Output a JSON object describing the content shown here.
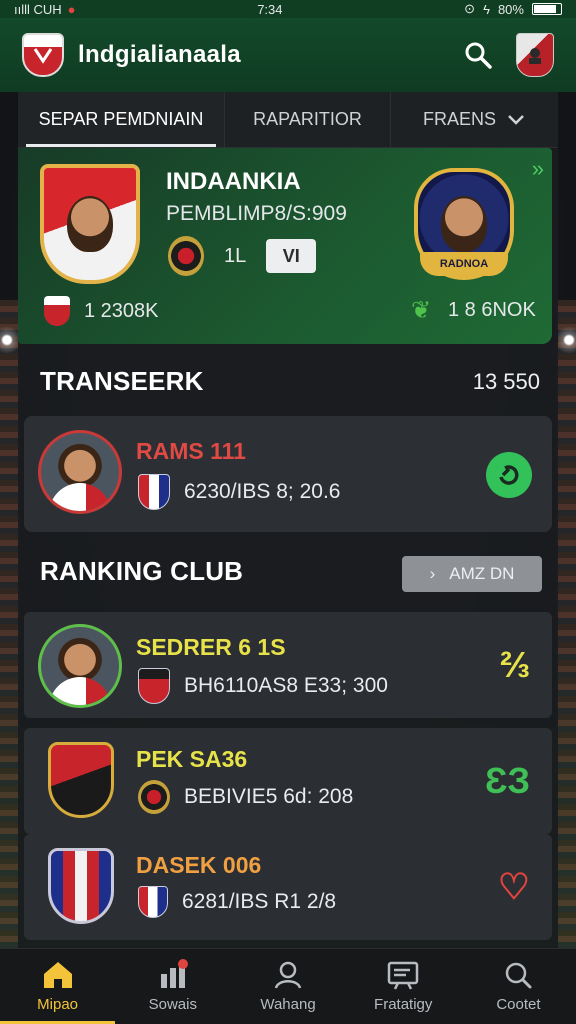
{
  "status_bar": {
    "carrier": "ıılll CUH",
    "time": "7:34",
    "battery": "80%"
  },
  "app_bar": {
    "title": "lndgialianaala"
  },
  "tabs": [
    {
      "label": "SEPAR PEMDNIAIN",
      "active": true
    },
    {
      "label": "RAPARITIOR",
      "active": false
    },
    {
      "label": "FRAENS",
      "active": false
    }
  ],
  "match": {
    "home_name": "INDAANKIA",
    "meta": "PEMBLIMP8/S:909",
    "score": "1L",
    "vs_label": "VI",
    "away_label": "RADNOA",
    "stat_left": "1 2308K",
    "stat_right": "1 8 6NOK"
  },
  "transfer": {
    "heading": "TRANSEERK",
    "count": "13 550",
    "card": {
      "title": "RAMS 111",
      "detail": "6230/IBS 8; 20.6"
    }
  },
  "ranking": {
    "heading": "RANKING CLUB",
    "see_all": "AMZ DN",
    "items": [
      {
        "title": "SEDRER 6 1S",
        "detail": "BH6110AS8 E33; 300",
        "title_color": "#e8e24a",
        "icon": "⅔",
        "icon_color": "#e8e24a"
      },
      {
        "title": "PEK SA36",
        "detail": "BEBIVIE5 6d: 208",
        "title_color": "#e8e24a",
        "icon": "ƐЗ",
        "icon_color": "#3fbf55"
      },
      {
        "title": "DASEK 006",
        "detail": "6281/IBS R1 2/8",
        "title_color": "#f0a042",
        "icon": "♡",
        "icon_color": "#e0443e"
      }
    ]
  },
  "bottom_nav": [
    {
      "label": "Mipao",
      "icon": "home-icon",
      "active": true
    },
    {
      "label": "Sowais",
      "icon": "chart-icon",
      "active": false
    },
    {
      "label": "Wahang",
      "icon": "user-icon",
      "active": false
    },
    {
      "label": "Fratatigy",
      "icon": "board-icon",
      "active": false
    },
    {
      "label": "Cootet",
      "icon": "search-icon",
      "active": false
    }
  ]
}
